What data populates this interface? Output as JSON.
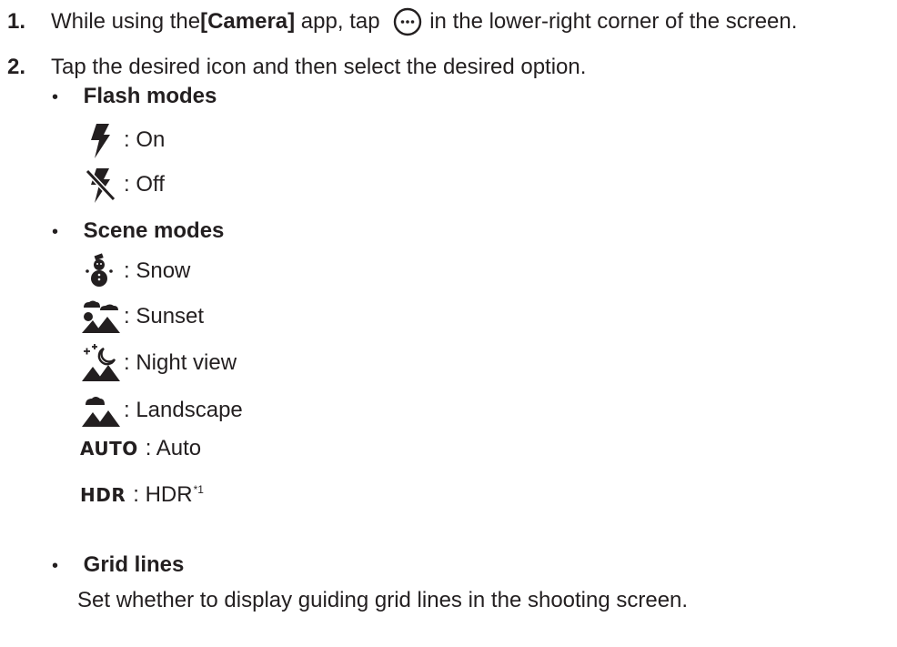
{
  "steps": [
    {
      "num": "1.",
      "pre": "While using the ",
      "app": "[Camera]",
      "mid": " app, tap ",
      "icon": "more-options-icon",
      "post": " in the lower-right corner of the screen."
    },
    {
      "num": "2.",
      "text": "Tap the desired icon and then select the desired option."
    }
  ],
  "bullet_glyph": "•",
  "flash": {
    "heading": "Flash modes",
    "options": [
      {
        "icon": "flash-on-icon",
        "label": ": On"
      },
      {
        "icon": "flash-off-icon",
        "label": ": Off"
      }
    ]
  },
  "scene": {
    "heading": "Scene modes",
    "options": [
      {
        "icon": "snowman-icon",
        "label": ": Snow"
      },
      {
        "icon": "sunset-icon",
        "label": ": Sunset"
      },
      {
        "icon": "night-view-icon",
        "label": ": Night view"
      },
      {
        "icon": "landscape-icon",
        "label": ": Landscape"
      },
      {
        "icon_text": "AUTO",
        "label": ": Auto"
      },
      {
        "icon_text": "HDR",
        "label": ": HDR",
        "footnote": "*1"
      }
    ]
  },
  "grid": {
    "heading": "Grid lines",
    "description": "Set whether to display guiding grid lines in the shooting screen."
  }
}
